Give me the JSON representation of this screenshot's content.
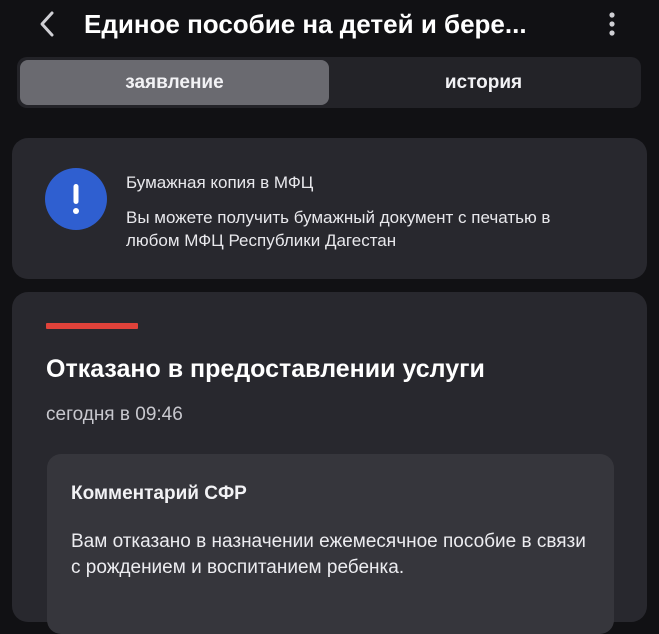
{
  "header": {
    "back_icon": "chevron-left-icon",
    "title": "Единое пособие на детей и бере...",
    "more_icon": "vertical-dots-icon"
  },
  "tabs": [
    {
      "label": "заявление",
      "active": true
    },
    {
      "label": "история",
      "active": false
    }
  ],
  "info_card": {
    "icon": "exclamation-icon",
    "icon_color": "#2f5fd0",
    "title": "Бумажная копия в МФЦ",
    "text": "Вы можете получить бумажный документ с печатью в любом МФЦ Республики Дагестан"
  },
  "status_card": {
    "status_color": "#e0423a",
    "title": "Отказано в предоставлении услуги",
    "time": "сегодня в 09:46",
    "comment": {
      "title": "Комментарий СФР",
      "text": "Вам отказано в назначении ежемесячное пособие в связи с рождением и воспитанием ребенка."
    }
  },
  "colors": {
    "background": "#111114",
    "card": "#28282e",
    "active_tab": "#6a6a70"
  }
}
